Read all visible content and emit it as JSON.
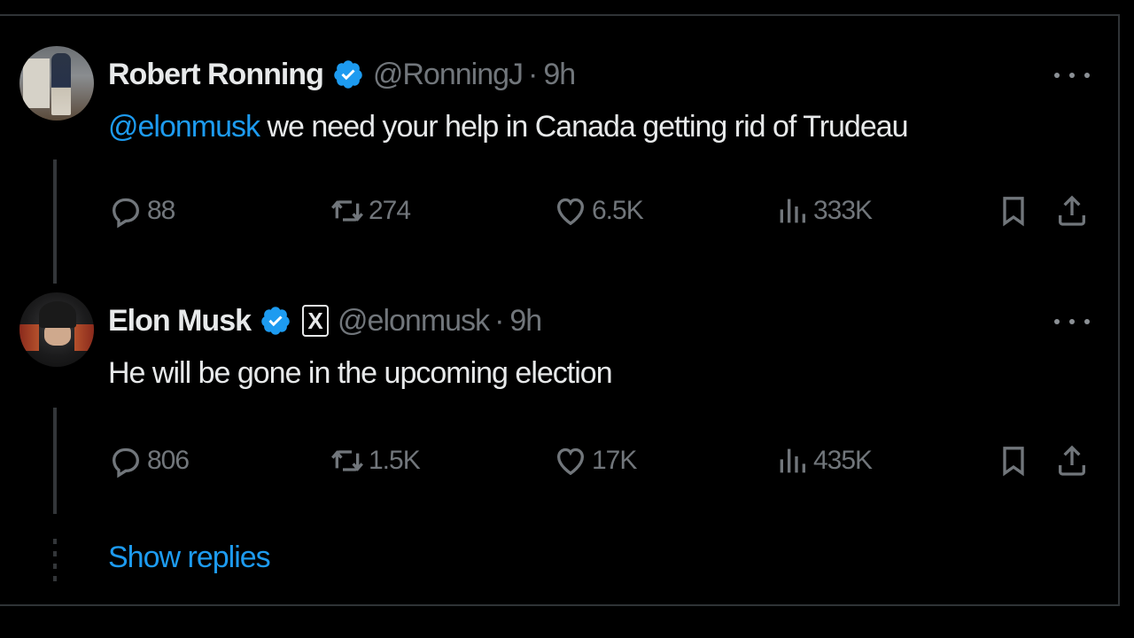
{
  "tweets": [
    {
      "name": "Robert Ronning",
      "handle": "@RonningJ",
      "separator": "·",
      "time": "9h",
      "mention": "@elonmusk",
      "text": " we need your help in Canada getting rid of Trudeau",
      "stats": {
        "replies": "88",
        "reposts": "274",
        "likes": "6.5K",
        "views": "333K"
      }
    },
    {
      "name": "Elon Musk",
      "badge": "X",
      "handle": "@elonmusk",
      "separator": "·",
      "time": "9h",
      "text": "He will be gone in the upcoming election",
      "stats": {
        "replies": "806",
        "reposts": "1.5K",
        "likes": "17K",
        "views": "435K"
      }
    }
  ],
  "show_replies": "Show replies",
  "colors": {
    "background": "#000000",
    "text": "#e7e9ea",
    "muted": "#71767b",
    "accent": "#1d9bf0",
    "border": "#2f3336"
  },
  "icons": {
    "reply": "reply-icon",
    "repost": "repost-icon",
    "like": "heart-icon",
    "views": "views-icon",
    "bookmark": "bookmark-icon",
    "share": "share-icon",
    "verified": "verified-badge-icon",
    "more": "more-icon"
  }
}
